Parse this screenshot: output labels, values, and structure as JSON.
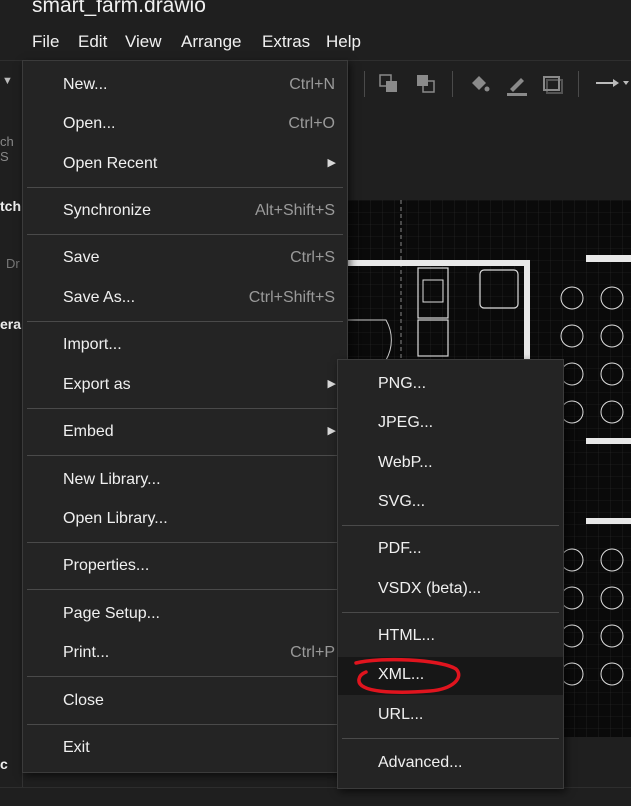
{
  "window": {
    "title": "smart_farm.drawio"
  },
  "menubar": {
    "items": [
      {
        "label": "File"
      },
      {
        "label": "Edit"
      },
      {
        "label": "View"
      },
      {
        "label": "Arrange"
      },
      {
        "label": "Extras"
      },
      {
        "label": "Help"
      }
    ]
  },
  "sidebar": {
    "search_fragment": "ch S",
    "scratchpad_fragment": "tch",
    "drag_fragment": "Dr",
    "general_fragment": "era",
    "bottom_fragment": "c"
  },
  "file_menu": {
    "items": [
      {
        "label": "New...",
        "shortcut": "Ctrl+N"
      },
      {
        "label": "Open...",
        "shortcut": "Ctrl+O"
      },
      {
        "label": "Open Recent",
        "submenu": true
      },
      {
        "label": "Synchronize",
        "shortcut": "Alt+Shift+S"
      },
      {
        "label": "Save",
        "shortcut": "Ctrl+S"
      },
      {
        "label": "Save As...",
        "shortcut": "Ctrl+Shift+S"
      },
      {
        "label": "Import..."
      },
      {
        "label": "Export as",
        "submenu": true
      },
      {
        "label": "Embed",
        "submenu": true
      },
      {
        "label": "New Library..."
      },
      {
        "label": "Open Library..."
      },
      {
        "label": "Properties..."
      },
      {
        "label": "Page Setup..."
      },
      {
        "label": "Print...",
        "shortcut": "Ctrl+P"
      },
      {
        "label": "Close"
      },
      {
        "label": "Exit"
      }
    ]
  },
  "export_menu": {
    "items": [
      {
        "label": "PNG..."
      },
      {
        "label": "JPEG..."
      },
      {
        "label": "WebP..."
      },
      {
        "label": "SVG..."
      },
      {
        "label": "PDF..."
      },
      {
        "label": "VSDX (beta)..."
      },
      {
        "label": "HTML..."
      },
      {
        "label": "XML...",
        "highlighted": true
      },
      {
        "label": "URL..."
      },
      {
        "label": "Advanced..."
      }
    ]
  },
  "colors": {
    "background": "#1f1f1f",
    "menu_bg": "#242424",
    "annotation_red": "#e0141e",
    "canvas_bg": "#0a0a0a"
  }
}
